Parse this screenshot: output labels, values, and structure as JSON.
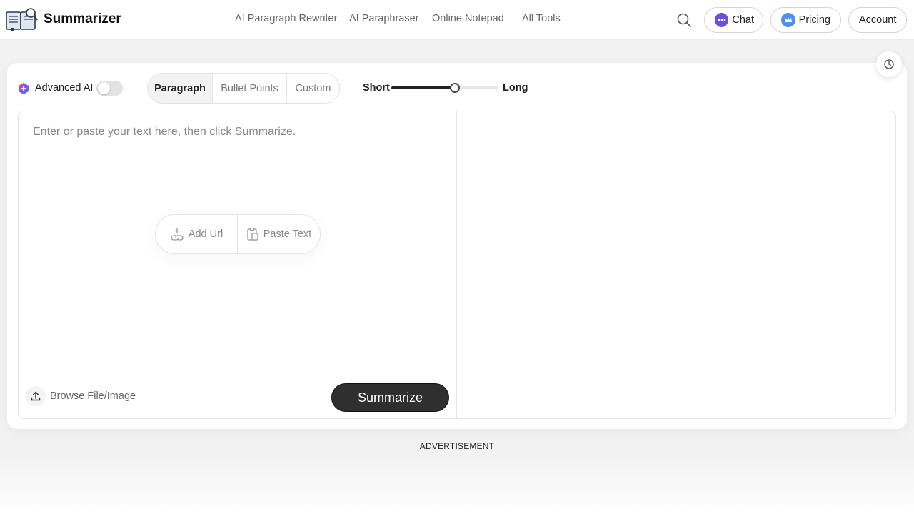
{
  "header": {
    "brand": "Summarizer",
    "nav": [
      "AI Paragraph Rewriter",
      "AI Paraphraser",
      "Online Notepad",
      "All Tools"
    ],
    "chat_label": "Chat",
    "pricing_label": "Pricing",
    "account_label": "Account"
  },
  "toolbar": {
    "advanced_ai_label": "Advanced AI",
    "advanced_ai_enabled": false,
    "modes": [
      "Paragraph",
      "Bullet Points",
      "Custom"
    ],
    "active_mode": "Paragraph",
    "length_short_label": "Short",
    "length_long_label": "Long",
    "length_value": 0.59
  },
  "editor": {
    "placeholder": "Enter or paste your text here, then click Summarize.",
    "add_url_label": "Add Url",
    "paste_text_label": "Paste Text",
    "browse_label": "Browse File/Image",
    "summarize_label": "Summarize"
  },
  "ad": {
    "label": "ADVERTISEMENT"
  },
  "colors": {
    "primary_button": "#2f2f2f",
    "chat_badge": "#6b4fe0",
    "pricing_badge": "#4f8ff0"
  }
}
